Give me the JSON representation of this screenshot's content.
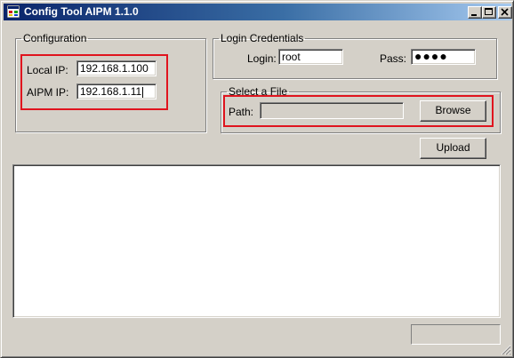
{
  "window": {
    "title": "Config Tool AIPM 1.1.0"
  },
  "configuration": {
    "legend": "Configuration",
    "local_ip_label": "Local IP:",
    "local_ip_value": "192.168.1.100",
    "aipm_ip_label": "AIPM IP:",
    "aipm_ip_value": "192.168.1.11"
  },
  "login": {
    "legend": "Login Credentials",
    "login_label": "Login:",
    "login_value": "root",
    "pass_label": "Pass:",
    "pass_value": "●●●●"
  },
  "file": {
    "legend": "Select a File",
    "path_label": "Path:",
    "path_value": "",
    "browse_label": "Browse"
  },
  "actions": {
    "upload_label": "Upload"
  },
  "log": {
    "text": ""
  },
  "progress": {
    "value": 0
  },
  "colors": {
    "highlight": "#e0141e",
    "face": "#d4d0c8",
    "title_start": "#0a246a",
    "title_end": "#a6caf0"
  },
  "icons": {
    "app": "app-window-icon",
    "minimize": "minimize-icon",
    "maximize": "maximize-icon",
    "close": "close-icon"
  }
}
